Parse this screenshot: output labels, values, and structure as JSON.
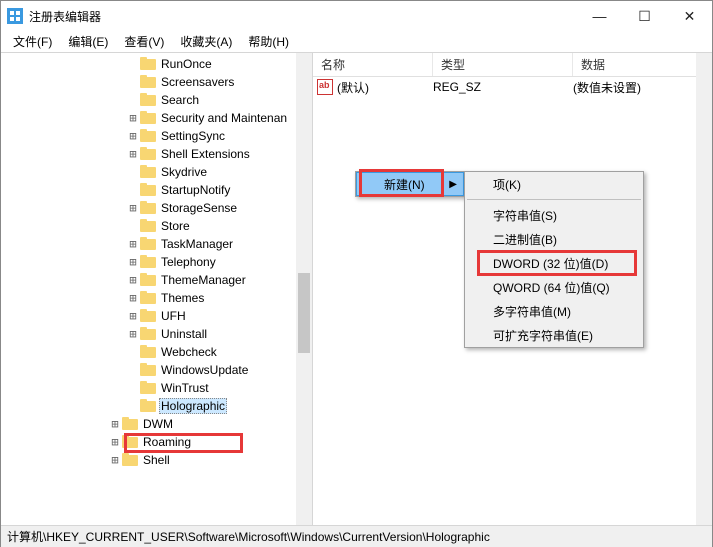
{
  "window": {
    "title": "注册表编辑器"
  },
  "menubar": {
    "file": "文件(F)",
    "edit": "编辑(E)",
    "view": "查看(V)",
    "favorites": "收藏夹(A)",
    "help": "帮助(H)"
  },
  "tree": {
    "items": [
      {
        "depth": 7,
        "exp": "",
        "label": "RunOnce"
      },
      {
        "depth": 7,
        "exp": "",
        "label": "Screensavers"
      },
      {
        "depth": 7,
        "exp": "",
        "label": "Search"
      },
      {
        "depth": 7,
        "exp": "⊞",
        "label": "Security and Maintenan"
      },
      {
        "depth": 7,
        "exp": "⊞",
        "label": "SettingSync"
      },
      {
        "depth": 7,
        "exp": "⊞",
        "label": "Shell Extensions"
      },
      {
        "depth": 7,
        "exp": "",
        "label": "Skydrive"
      },
      {
        "depth": 7,
        "exp": "",
        "label": "StartupNotify"
      },
      {
        "depth": 7,
        "exp": "⊞",
        "label": "StorageSense"
      },
      {
        "depth": 7,
        "exp": "",
        "label": "Store"
      },
      {
        "depth": 7,
        "exp": "⊞",
        "label": "TaskManager"
      },
      {
        "depth": 7,
        "exp": "⊞",
        "label": "Telephony"
      },
      {
        "depth": 7,
        "exp": "⊞",
        "label": "ThemeManager"
      },
      {
        "depth": 7,
        "exp": "⊞",
        "label": "Themes"
      },
      {
        "depth": 7,
        "exp": "⊞",
        "label": "UFH"
      },
      {
        "depth": 7,
        "exp": "⊞",
        "label": "Uninstall"
      },
      {
        "depth": 7,
        "exp": "",
        "label": "Webcheck"
      },
      {
        "depth": 7,
        "exp": "",
        "label": "WindowsUpdate"
      },
      {
        "depth": 7,
        "exp": "",
        "label": "WinTrust"
      },
      {
        "depth": 7,
        "exp": "",
        "label": "Holographic",
        "selected": true
      },
      {
        "depth": 6,
        "exp": "⊞",
        "label": "DWM"
      },
      {
        "depth": 6,
        "exp": "⊞",
        "label": "Roaming"
      },
      {
        "depth": 6,
        "exp": "⊞",
        "label": "Shell"
      }
    ]
  },
  "list": {
    "headers": {
      "name": "名称",
      "type": "类型",
      "data": "数据"
    },
    "rows": [
      {
        "name": "(默认)",
        "type": "REG_SZ",
        "data": "(数值未设置)"
      }
    ]
  },
  "context": {
    "new": "新建(N)",
    "submenu": {
      "key": "项(K)",
      "string": "字符串值(S)",
      "binary": "二进制值(B)",
      "dword": "DWORD (32 位)值(D)",
      "qword": "QWORD (64 位)值(Q)",
      "multi": "多字符串值(M)",
      "expand": "可扩充字符串值(E)"
    }
  },
  "statusbar": {
    "path": "计算机\\HKEY_CURRENT_USER\\Software\\Microsoft\\Windows\\CurrentVersion\\Holographic"
  }
}
